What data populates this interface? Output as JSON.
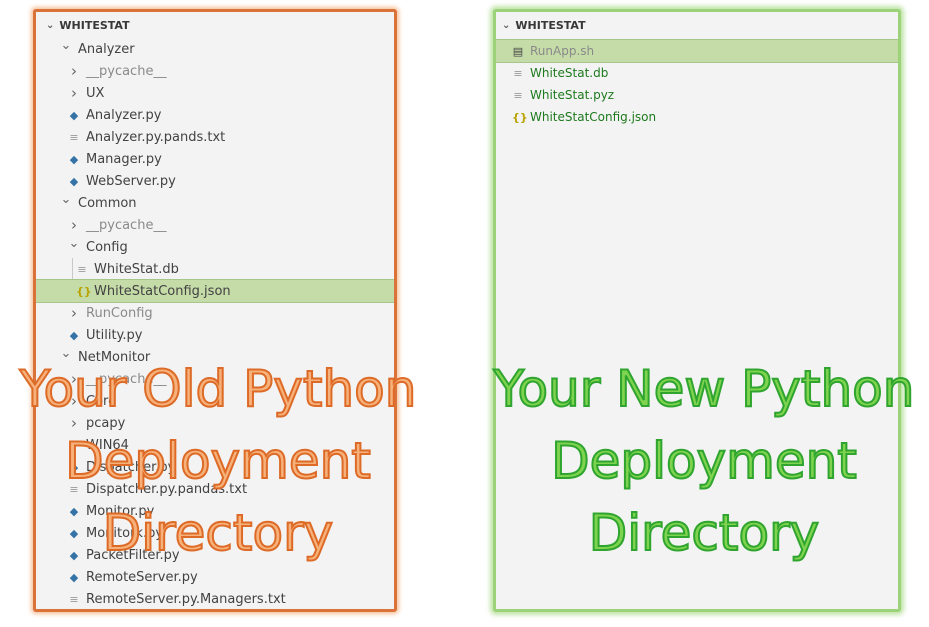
{
  "old_explorer": {
    "header": "WHITESTAT",
    "rows": [
      {
        "label": "Analyzer",
        "icon": "chevron-down-icon",
        "indent": 1,
        "style": "normal"
      },
      {
        "label": "__pycache__",
        "icon": "chevron-right-icon",
        "indent": 2,
        "style": "dim"
      },
      {
        "label": "UX",
        "icon": "chevron-right-icon",
        "indent": 2,
        "style": "normal"
      },
      {
        "label": "Analyzer.py",
        "icon": "python-file-icon",
        "indent": 2,
        "style": "normal"
      },
      {
        "label": "Analyzer.py.pands.txt",
        "icon": "text-file-icon",
        "indent": 2,
        "style": "normal"
      },
      {
        "label": "Manager.py",
        "icon": "python-file-icon",
        "indent": 2,
        "style": "normal"
      },
      {
        "label": "WebServer.py",
        "icon": "python-file-icon",
        "indent": 2,
        "style": "normal"
      },
      {
        "label": "Common",
        "icon": "chevron-down-icon",
        "indent": 1,
        "style": "normal"
      },
      {
        "label": "__pycache__",
        "icon": "chevron-right-icon",
        "indent": 2,
        "style": "dim"
      },
      {
        "label": "Config",
        "icon": "chevron-down-icon",
        "indent": 2,
        "style": "normal"
      },
      {
        "label": "WhiteStat.db",
        "icon": "text-file-icon",
        "indent": 3,
        "style": "normal"
      },
      {
        "label": "WhiteStatConfig.json",
        "icon": "json-file-icon",
        "indent": 3,
        "style": "selected"
      },
      {
        "label": "RunConfig",
        "icon": "chevron-right-icon",
        "indent": 2,
        "style": "dim"
      },
      {
        "label": "Utility.py",
        "icon": "python-file-icon",
        "indent": 2,
        "style": "normal"
      },
      {
        "label": "NetMonitor",
        "icon": "chevron-down-icon",
        "indent": 1,
        "style": "normal"
      },
      {
        "label": "__pycache__",
        "icon": "chevron-right-icon",
        "indent": 2,
        "style": "dim"
      },
      {
        "label": "Core",
        "icon": "chevron-right-icon",
        "indent": 2,
        "style": "normal"
      },
      {
        "label": "pcapy",
        "icon": "chevron-right-icon",
        "indent": 2,
        "style": "normal"
      },
      {
        "label": "WIN64",
        "icon": "chevron-right-icon",
        "indent": 2,
        "style": "normal"
      },
      {
        "label": "Dispatcher.py",
        "icon": "python-file-icon",
        "indent": 2,
        "style": "normal"
      },
      {
        "label": "Dispatcher.py.pandas.txt",
        "icon": "text-file-icon",
        "indent": 2,
        "style": "normal"
      },
      {
        "label": "Monitor.py",
        "icon": "python-file-icon",
        "indent": 2,
        "style": "normal"
      },
      {
        "label": "Monitork.py",
        "icon": "python-file-icon",
        "indent": 2,
        "style": "normal"
      },
      {
        "label": "PacketFilter.py",
        "icon": "python-file-icon",
        "indent": 2,
        "style": "normal"
      },
      {
        "label": "RemoteServer.py",
        "icon": "python-file-icon",
        "indent": 2,
        "style": "normal"
      },
      {
        "label": "RemoteServer.py.Managers.txt",
        "icon": "text-file-icon",
        "indent": 2,
        "style": "normal"
      }
    ]
  },
  "new_explorer": {
    "header": "WHITESTAT",
    "rows": [
      {
        "label": "RunApp.sh",
        "icon": "shell-file-icon",
        "style": "selected"
      },
      {
        "label": "WhiteStat.db",
        "icon": "text-file-icon",
        "style": "green"
      },
      {
        "label": "WhiteStat.pyz",
        "icon": "text-file-icon",
        "style": "green"
      },
      {
        "label": "WhiteStatConfig.json",
        "icon": "json-file-icon",
        "style": "green"
      }
    ]
  },
  "captions": {
    "old": [
      "Your Old Python",
      "Deployment",
      "Directory"
    ],
    "new": [
      "Your New Python",
      "Deployment",
      "Directory"
    ]
  },
  "colors": {
    "old_accent": "#dd6b27",
    "new_accent": "#2fa52f",
    "selection": "#c5dba8"
  }
}
